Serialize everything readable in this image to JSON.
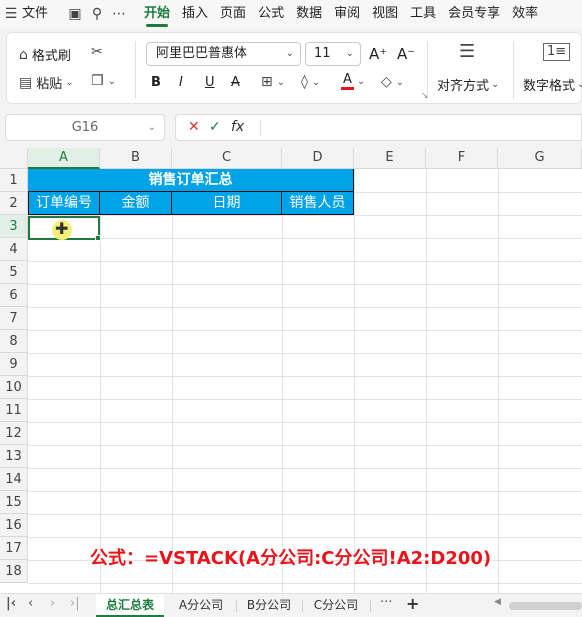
{
  "menu": {
    "file": "文件",
    "tabs": [
      "开始",
      "插入",
      "页面",
      "公式",
      "数据",
      "审阅",
      "视图",
      "工具",
      "会员专享",
      "效率"
    ],
    "active_tab": "开始"
  },
  "ribbon": {
    "format_painter": "格式刷",
    "paste": "粘贴",
    "font_name": "阿里巴巴普惠体",
    "font_size": "11",
    "align": "对齐方式",
    "number_format": "数字格式",
    "bold": "B",
    "italic": "I",
    "underline": "U",
    "strike": "A",
    "grow": "A⁺",
    "shrink": "A⁻"
  },
  "formula_bar": {
    "name_box": "G16",
    "fx": "fx",
    "value": ""
  },
  "columns": [
    "A",
    "B",
    "C",
    "D",
    "E",
    "F",
    "G"
  ],
  "rows": [
    "1",
    "2",
    "3",
    "4",
    "5",
    "6",
    "7",
    "8",
    "9",
    "10",
    "11",
    "12",
    "13",
    "14",
    "15",
    "16",
    "17",
    "18"
  ],
  "table": {
    "title": "销售订单汇总",
    "headers": [
      "订单编号",
      "金额",
      "日期",
      "销售人员"
    ]
  },
  "formula_note": "公式：=VSTACK(A分公司:C分公司!A2:D200)",
  "sheets": {
    "tabs": [
      "总汇总表",
      "A分公司",
      "B分公司",
      "C分公司"
    ],
    "active": "总汇总表",
    "more": "···",
    "add": "+"
  },
  "colors": {
    "accent": "#1e7b3c",
    "header_fill": "#00a2e8",
    "note_red": "#e8141a"
  }
}
